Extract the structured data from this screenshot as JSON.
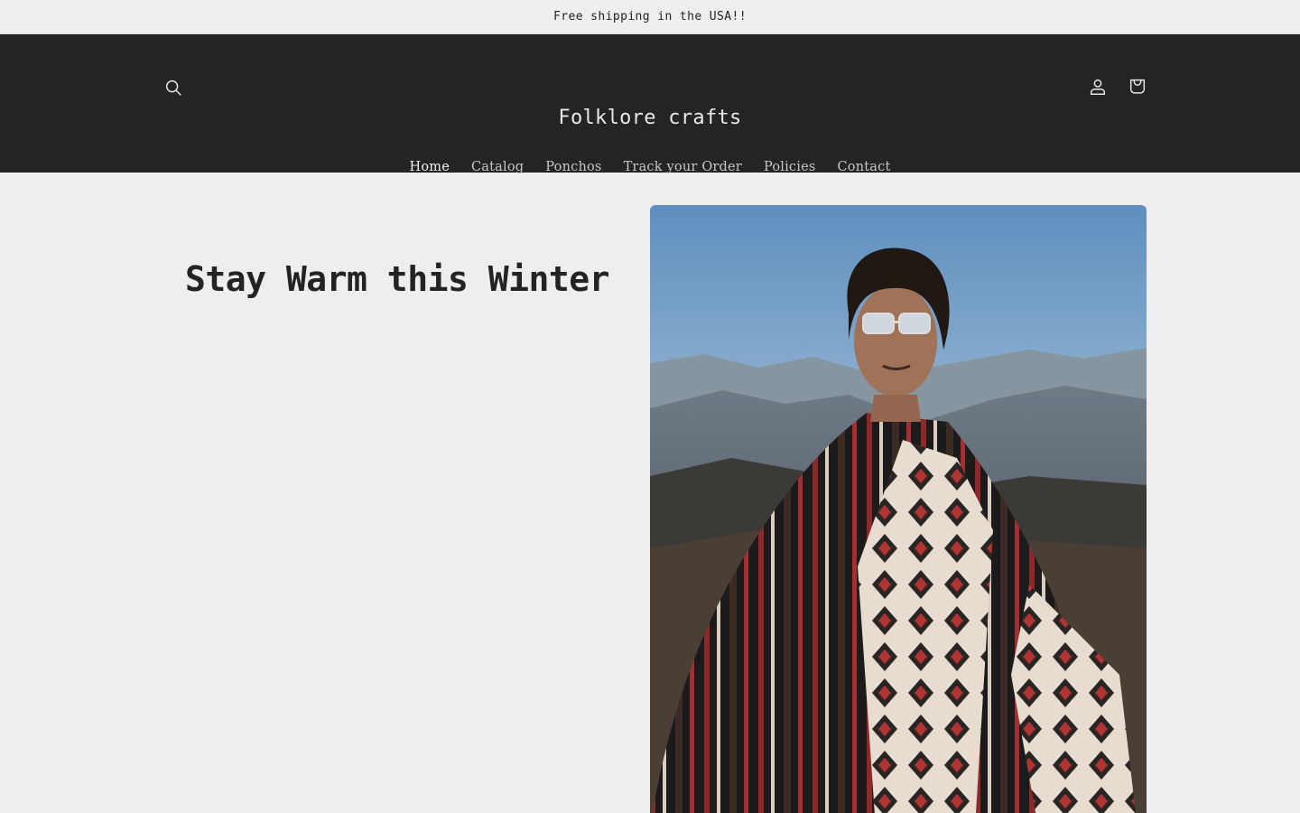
{
  "announcement": {
    "text": "Free shipping in the USA!!"
  },
  "header": {
    "logo": "Folklore crafts",
    "icons": {
      "search": "search-icon",
      "account": "account-icon",
      "cart": "cart-icon"
    },
    "nav": [
      {
        "label": "Home",
        "active": true
      },
      {
        "label": "Catalog",
        "active": false
      },
      {
        "label": "Ponchos",
        "active": false
      },
      {
        "label": "Track your Order",
        "active": false
      },
      {
        "label": "Policies",
        "active": false
      },
      {
        "label": "Contact",
        "active": false
      }
    ]
  },
  "hero": {
    "title": "Stay Warm this Winter",
    "image_alt": "Man wearing a patterned poncho in the mountains"
  },
  "colors": {
    "header_bg": "#242424",
    "page_bg": "#efeeec",
    "text": "#232323"
  }
}
